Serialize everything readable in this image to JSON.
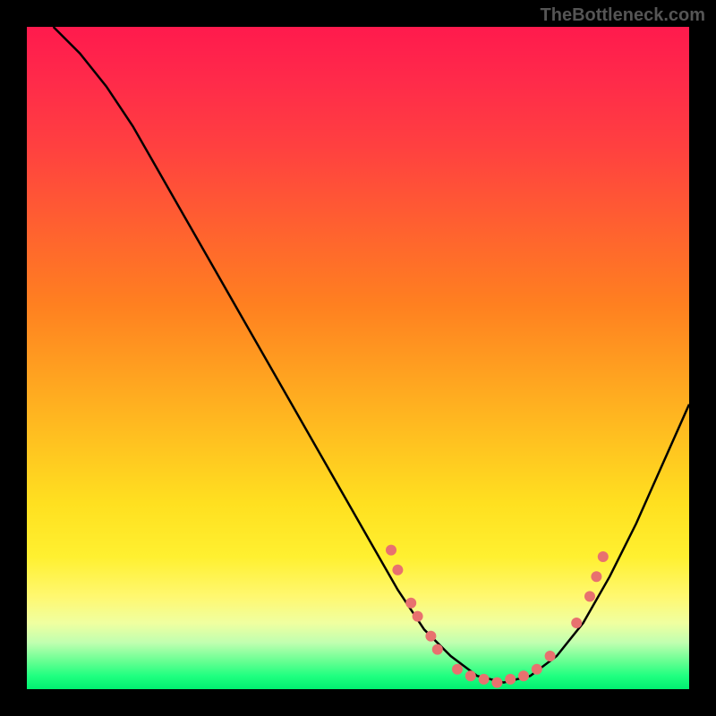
{
  "watermark": "TheBottleneck.com",
  "chart_data": {
    "type": "line",
    "title": "",
    "xlabel": "",
    "ylabel": "",
    "xlim": [
      0,
      100
    ],
    "ylim": [
      0,
      100
    ],
    "curve": {
      "x": [
        4,
        8,
        12,
        16,
        20,
        24,
        28,
        32,
        36,
        40,
        44,
        48,
        52,
        56,
        60,
        64,
        68,
        72,
        76,
        80,
        84,
        88,
        92,
        96,
        100
      ],
      "y": [
        100,
        96,
        91,
        85,
        78,
        71,
        64,
        57,
        50,
        43,
        36,
        29,
        22,
        15,
        9,
        5,
        2,
        1,
        2,
        5,
        10,
        17,
        25,
        34,
        43
      ]
    },
    "points": [
      {
        "x": 55,
        "y": 21
      },
      {
        "x": 56,
        "y": 18
      },
      {
        "x": 58,
        "y": 13
      },
      {
        "x": 59,
        "y": 11
      },
      {
        "x": 61,
        "y": 8
      },
      {
        "x": 62,
        "y": 6
      },
      {
        "x": 65,
        "y": 3
      },
      {
        "x": 67,
        "y": 2
      },
      {
        "x": 69,
        "y": 1.5
      },
      {
        "x": 71,
        "y": 1
      },
      {
        "x": 73,
        "y": 1.5
      },
      {
        "x": 75,
        "y": 2
      },
      {
        "x": 77,
        "y": 3
      },
      {
        "x": 79,
        "y": 5
      },
      {
        "x": 83,
        "y": 10
      },
      {
        "x": 85,
        "y": 14
      },
      {
        "x": 86,
        "y": 17
      },
      {
        "x": 87,
        "y": 20
      }
    ],
    "point_color": "#e8716f",
    "curve_color": "#000000"
  }
}
